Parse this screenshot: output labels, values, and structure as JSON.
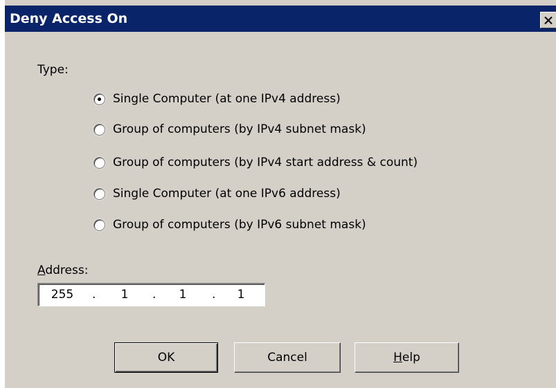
{
  "dialog": {
    "title": "Deny Access On"
  },
  "type_section": {
    "label": "Type:",
    "options": [
      {
        "label": "Single Computer (at one IPv4 address)",
        "checked": true
      },
      {
        "label": "Group of computers (by IPv4 subnet mask)",
        "checked": false
      },
      {
        "label": "Group of computers (by IPv4 start address & count)",
        "checked": false
      },
      {
        "label": "Single Computer (at one IPv6 address)",
        "checked": false
      },
      {
        "label": "Group of computers (by IPv6 subnet mask)",
        "checked": false
      }
    ]
  },
  "address": {
    "label_mnemonic": "A",
    "label_rest": "ddress:",
    "octets": [
      "255",
      "1",
      "1",
      "1"
    ],
    "separator": "."
  },
  "buttons": {
    "ok": "OK",
    "cancel": "Cancel",
    "help_mnemonic": "H",
    "help_rest": "elp"
  }
}
